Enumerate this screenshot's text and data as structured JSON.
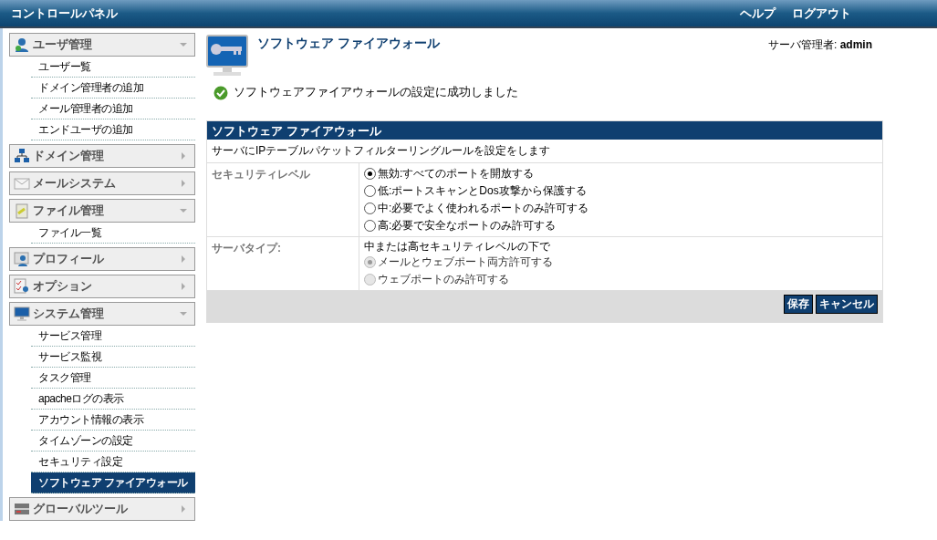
{
  "header": {
    "title": "コントロールパネル",
    "links": [
      "ヘルプ",
      "ログアウト"
    ]
  },
  "sidebar": {
    "sections": [
      {
        "kind": "user",
        "label": "ユーザ管理",
        "expanded": true,
        "items": [
          {
            "label": "ユーザー覧",
            "selected": false
          },
          {
            "label": "ドメイン管理者の追加",
            "selected": false
          },
          {
            "label": "メール管理者の追加",
            "selected": false
          },
          {
            "label": "エンドユーザの追加",
            "selected": false
          }
        ]
      },
      {
        "kind": "network",
        "label": "ドメイン管理",
        "expanded": false
      },
      {
        "kind": "mail",
        "label": "メールシステム",
        "expanded": false
      },
      {
        "kind": "file",
        "label": "ファイル管理",
        "expanded": true,
        "items": [
          {
            "label": "ファイル一覧",
            "selected": false
          }
        ]
      },
      {
        "kind": "profile",
        "label": "プロフィール",
        "expanded": false
      },
      {
        "kind": "options",
        "label": "オプション",
        "expanded": false
      },
      {
        "kind": "system",
        "label": "システム管理",
        "expanded": true,
        "items": [
          {
            "label": "サービス管理",
            "selected": false
          },
          {
            "label": "サービス監視",
            "selected": false
          },
          {
            "label": "タスク管理",
            "selected": false
          },
          {
            "label": "apacheログの表示",
            "selected": false
          },
          {
            "label": "アカウント情報の表示",
            "selected": false
          },
          {
            "label": "タイムゾーンの設定",
            "selected": false
          },
          {
            "label": "セキュリティ設定",
            "selected": false
          },
          {
            "label": "ソフトウェア ファイアウォール",
            "selected": true
          }
        ]
      },
      {
        "kind": "global",
        "label": "グローバルツール",
        "expanded": false
      }
    ]
  },
  "page": {
    "title": "ソフトウェア ファイアウォール",
    "user_label": "サーバ管理者:",
    "user": "admin",
    "message": "ソフトウェアファイアウォールの設定に成功しました"
  },
  "panel": {
    "title": "ソフトウェア ファイアウォール",
    "description": "サーバにIPテーブルパケットフィルターリングルールを設定をします",
    "rows": [
      {
        "label": "セキュリティレベル",
        "note": null,
        "options": [
          {
            "label": "無効:すべてのポートを開放する",
            "selected": true,
            "disabled": false
          },
          {
            "label": "低:ポートスキャンとDos攻撃から保護する",
            "selected": false,
            "disabled": false
          },
          {
            "label": "中:必要でよく使われるポートのみ許可する",
            "selected": false,
            "disabled": false
          },
          {
            "label": "高:必要で安全なポートのみ許可する",
            "selected": false,
            "disabled": false
          }
        ]
      },
      {
        "label": "サーバタイプ:",
        "note": "中または高セキュリティレベルの下で",
        "options": [
          {
            "label": "メールとウェブポート両方許可する",
            "selected": true,
            "disabled": true
          },
          {
            "label": "ウェブポートのみ許可する",
            "selected": false,
            "disabled": true
          }
        ]
      }
    ],
    "buttons": [
      "保存",
      "キャンセル"
    ]
  }
}
